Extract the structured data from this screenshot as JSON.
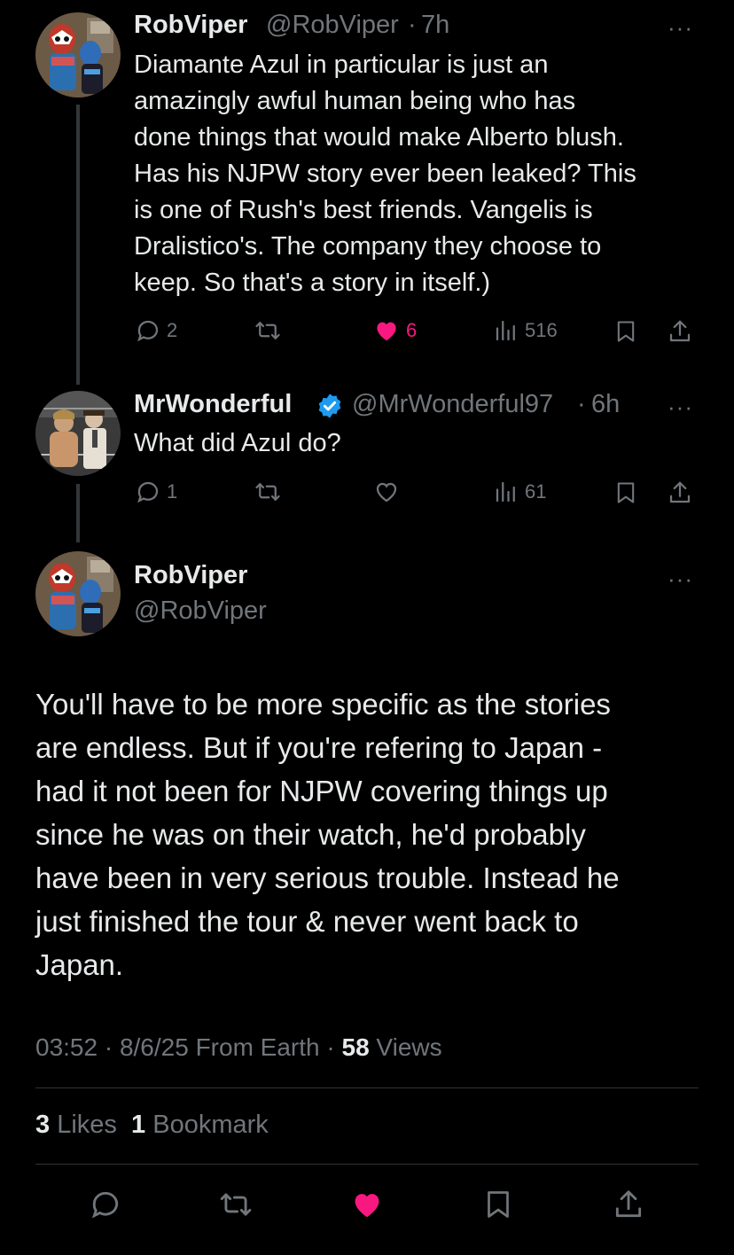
{
  "tweet1": {
    "name": "RobViper",
    "handle": "@RobViper",
    "sep": "·",
    "time": "7h",
    "more": "···",
    "lines": [
      "Diamante Azul in particular is just an",
      "amazingly awful human being who has",
      "done things that would make Alberto blush.",
      "Has his NJPW story ever been leaked? This",
      "is one of Rush's best friends. Vangelis is",
      "Dralistico's. The company they choose to",
      "keep. So that's a story in itself.)"
    ],
    "replies": "2",
    "likes": "6",
    "views": "516",
    "liked": true
  },
  "tweet2": {
    "name": "MrWonderful",
    "handle": "@MrWonderful97",
    "sep": "·",
    "time": "6h",
    "more": "···",
    "text": "What did Azul do?",
    "replies": "1",
    "views": "61",
    "verified": true
  },
  "main": {
    "name": "RobViper",
    "handle": "@RobViper",
    "more": "···",
    "lines": [
      "You'll have to be more specific as the stories",
      "are endless. But if you're refering to Japan -",
      "had it not been for NJPW covering things up",
      "since he was on their watch, he'd probably",
      "have been in very serious trouble. Instead he",
      "just finished the tour & never went back to",
      "Japan."
    ],
    "timestamp": "03:52 · 8/6/25 From Earth · ",
    "views_count": "58",
    "views_label": " Views",
    "likes_count": "3",
    "likes_label": " Likes",
    "bookmarks_count": "1",
    "bookmarks_label": " Bookmark"
  },
  "colors": {
    "like": "#f91880",
    "verified": "#1d9bf0",
    "muted": "#71767b",
    "text": "#e7e9ea"
  }
}
